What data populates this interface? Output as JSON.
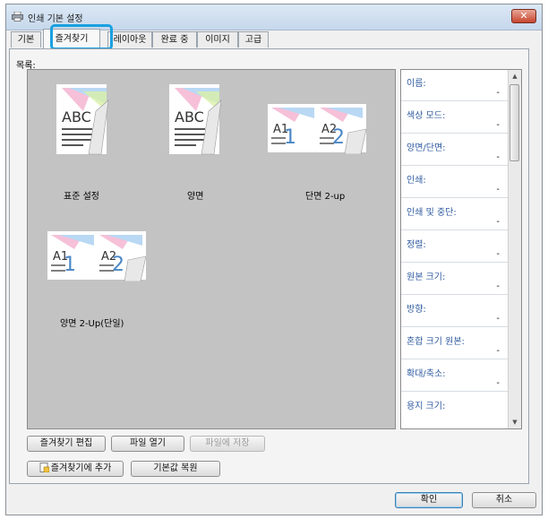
{
  "window": {
    "title": "인쇄 기본 설정",
    "close_label": "✕"
  },
  "tabs": [
    {
      "label": "기본"
    },
    {
      "label": "즐겨찾기"
    },
    {
      "label": "레이아웃"
    },
    {
      "label": "완료 중"
    },
    {
      "label": "이미지"
    },
    {
      "label": "고급"
    }
  ],
  "favorites": {
    "label": "목록:",
    "items": [
      {
        "label": "표준 설정",
        "thumb_text": "ABC"
      },
      {
        "label": "양면",
        "thumb_text": "ABC"
      },
      {
        "label": "단면 2-up",
        "thumb_text_1": "A1",
        "thumb_text_2": "A2"
      },
      {
        "label": "양면 2-Up(단일)",
        "thumb_text_1": "A1",
        "thumb_text_2": "A2"
      }
    ]
  },
  "properties": [
    {
      "label": "이름:",
      "value": "-"
    },
    {
      "label": "색상 모드:",
      "value": "-"
    },
    {
      "label": "양면/단면:",
      "value": "-"
    },
    {
      "label": "인쇄:",
      "value": "-"
    },
    {
      "label": "인쇄 및 중단:",
      "value": "-"
    },
    {
      "label": "정렬:",
      "value": "-"
    },
    {
      "label": "원본 크기:",
      "value": "-"
    },
    {
      "label": "방향:",
      "value": "-"
    },
    {
      "label": "혼합 크기 원본:",
      "value": "-"
    },
    {
      "label": "확대/축소:",
      "value": "-"
    },
    {
      "label": "용지 크기:",
      "value": ""
    }
  ],
  "buttons": {
    "edit_favorites": "즐겨찾기 편집",
    "open_file": "파일 열기",
    "save_to_file": "파일에 저장",
    "add_to_favorites": "즐겨찾기에 추가",
    "restore_defaults": "기본값 복원",
    "ok": "확인",
    "cancel": "취소"
  },
  "colors": {
    "highlight": "#1aa0e0",
    "property_label": "#2f5ba0",
    "list_background": "#c3c3c3"
  }
}
